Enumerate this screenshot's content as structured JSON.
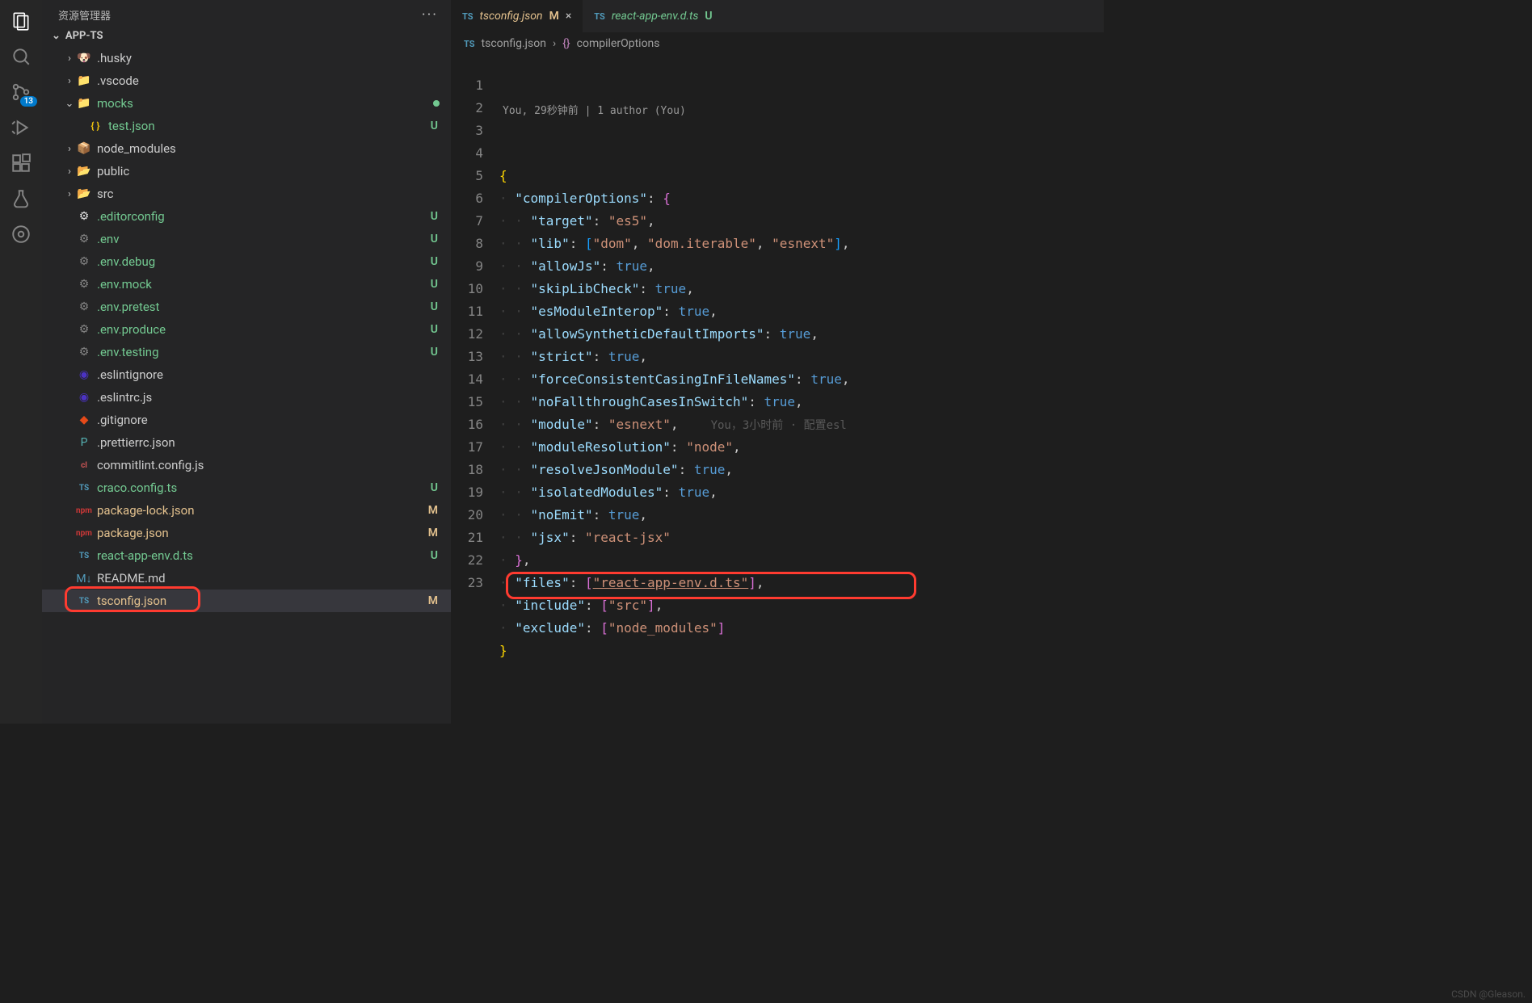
{
  "activityBar": {
    "badge": "13"
  },
  "sidebar": {
    "title": "资源管理器",
    "project": "APP-TS",
    "tree": [
      {
        "type": "folder",
        "name": ".husky",
        "depth": 1,
        "expanded": false,
        "color": "normal",
        "icon": "folder-husky"
      },
      {
        "type": "folder",
        "name": ".vscode",
        "depth": 1,
        "expanded": false,
        "color": "normal",
        "icon": "folder-vscode"
      },
      {
        "type": "folder",
        "name": "mocks",
        "depth": 1,
        "expanded": true,
        "color": "u",
        "status": "dot",
        "icon": "folder-mock"
      },
      {
        "type": "file",
        "name": "test.json",
        "depth": 2,
        "color": "u",
        "status": "U",
        "icon": "json"
      },
      {
        "type": "folder",
        "name": "node_modules",
        "depth": 1,
        "expanded": false,
        "color": "normal",
        "icon": "folder-node"
      },
      {
        "type": "folder",
        "name": "public",
        "depth": 1,
        "expanded": false,
        "color": "normal",
        "icon": "folder-public"
      },
      {
        "type": "folder",
        "name": "src",
        "depth": 1,
        "expanded": false,
        "color": "normal",
        "icon": "folder-src"
      },
      {
        "type": "file",
        "name": ".editorconfig",
        "depth": 1,
        "color": "u",
        "status": "U",
        "icon": "editorconfig"
      },
      {
        "type": "file",
        "name": ".env",
        "depth": 1,
        "color": "u",
        "status": "U",
        "icon": "gear"
      },
      {
        "type": "file",
        "name": ".env.debug",
        "depth": 1,
        "color": "u",
        "status": "U",
        "icon": "gear"
      },
      {
        "type": "file",
        "name": ".env.mock",
        "depth": 1,
        "color": "u",
        "status": "U",
        "icon": "gear"
      },
      {
        "type": "file",
        "name": ".env.pretest",
        "depth": 1,
        "color": "u",
        "status": "U",
        "icon": "gear"
      },
      {
        "type": "file",
        "name": ".env.produce",
        "depth": 1,
        "color": "u",
        "status": "U",
        "icon": "gear"
      },
      {
        "type": "file",
        "name": ".env.testing",
        "depth": 1,
        "color": "u",
        "status": "U",
        "icon": "gear"
      },
      {
        "type": "file",
        "name": ".eslintignore",
        "depth": 1,
        "color": "normal",
        "status": "",
        "icon": "eslint"
      },
      {
        "type": "file",
        "name": ".eslintrc.js",
        "depth": 1,
        "color": "normal",
        "status": "",
        "icon": "eslint"
      },
      {
        "type": "file",
        "name": ".gitignore",
        "depth": 1,
        "color": "normal",
        "status": "",
        "icon": "git"
      },
      {
        "type": "file",
        "name": ".prettierrc.json",
        "depth": 1,
        "color": "normal",
        "status": "",
        "icon": "prettier"
      },
      {
        "type": "file",
        "name": "commitlint.config.js",
        "depth": 1,
        "color": "normal",
        "status": "",
        "icon": "commitlint"
      },
      {
        "type": "file",
        "name": "craco.config.ts",
        "depth": 1,
        "color": "u",
        "status": "U",
        "icon": "ts"
      },
      {
        "type": "file",
        "name": "package-lock.json",
        "depth": 1,
        "color": "m",
        "status": "M",
        "icon": "npm"
      },
      {
        "type": "file",
        "name": "package.json",
        "depth": 1,
        "color": "m",
        "status": "M",
        "icon": "npm"
      },
      {
        "type": "file",
        "name": "react-app-env.d.ts",
        "depth": 1,
        "color": "u",
        "status": "U",
        "icon": "ts"
      },
      {
        "type": "file",
        "name": "README.md",
        "depth": 1,
        "color": "normal",
        "status": "",
        "icon": "md"
      },
      {
        "type": "file",
        "name": "tsconfig.json",
        "depth": 1,
        "color": "m",
        "status": "M",
        "icon": "ts",
        "selected": true
      }
    ]
  },
  "tabs": [
    {
      "label": "tsconfig.json",
      "status": "M",
      "statusColor": "m",
      "active": true,
      "icon": "ts"
    },
    {
      "label": "react-app-env.d.ts",
      "status": "U",
      "statusColor": "u",
      "active": false,
      "icon": "ts"
    }
  ],
  "breadcrumb": {
    "file": "tsconfig.json",
    "symbol": "compilerOptions"
  },
  "codelens": "You, 29秒钟前 | 1 author (You)",
  "gitlensInline": "You，3小时前 · 配置esl",
  "code": {
    "lines": [
      {
        "n": 1,
        "tokens": [
          [
            "brace",
            "{"
          ]
        ]
      },
      {
        "n": 2,
        "tokens": [
          [
            "ind",
            1
          ],
          [
            "key",
            "\"compilerOptions\""
          ],
          [
            "punc",
            ": "
          ],
          [
            "brace2",
            "{"
          ]
        ]
      },
      {
        "n": 3,
        "tokens": [
          [
            "ind",
            2
          ],
          [
            "key",
            "\"target\""
          ],
          [
            "punc",
            ": "
          ],
          [
            "str",
            "\"es5\""
          ],
          [
            "punc",
            ","
          ]
        ]
      },
      {
        "n": 4,
        "tokens": [
          [
            "ind",
            2
          ],
          [
            "key",
            "\"lib\""
          ],
          [
            "punc",
            ": "
          ],
          [
            "bracket",
            "["
          ],
          [
            "str",
            "\"dom\""
          ],
          [
            "punc",
            ", "
          ],
          [
            "str",
            "\"dom.iterable\""
          ],
          [
            "punc",
            ", "
          ],
          [
            "str",
            "\"esnext\""
          ],
          [
            "bracket",
            "]"
          ],
          [
            "punc",
            ","
          ]
        ]
      },
      {
        "n": 5,
        "tokens": [
          [
            "ind",
            2
          ],
          [
            "key",
            "\"allowJs\""
          ],
          [
            "punc",
            ": "
          ],
          [
            "bool",
            "true"
          ],
          [
            "punc",
            ","
          ]
        ]
      },
      {
        "n": 6,
        "tokens": [
          [
            "ind",
            2
          ],
          [
            "key",
            "\"skipLibCheck\""
          ],
          [
            "punc",
            ": "
          ],
          [
            "bool",
            "true"
          ],
          [
            "punc",
            ","
          ]
        ]
      },
      {
        "n": 7,
        "tokens": [
          [
            "ind",
            2
          ],
          [
            "key",
            "\"esModuleInterop\""
          ],
          [
            "punc",
            ": "
          ],
          [
            "bool",
            "true"
          ],
          [
            "punc",
            ","
          ]
        ]
      },
      {
        "n": 8,
        "tokens": [
          [
            "ind",
            2
          ],
          [
            "key",
            "\"allowSyntheticDefaultImports\""
          ],
          [
            "punc",
            ": "
          ],
          [
            "bool",
            "true"
          ],
          [
            "punc",
            ","
          ]
        ]
      },
      {
        "n": 9,
        "tokens": [
          [
            "ind",
            2
          ],
          [
            "key",
            "\"strict\""
          ],
          [
            "punc",
            ": "
          ],
          [
            "bool",
            "true"
          ],
          [
            "punc",
            ","
          ]
        ]
      },
      {
        "n": 10,
        "tokens": [
          [
            "ind",
            2
          ],
          [
            "key",
            "\"forceConsistentCasingInFileNames\""
          ],
          [
            "punc",
            ": "
          ],
          [
            "bool",
            "true"
          ],
          [
            "punc",
            ","
          ]
        ]
      },
      {
        "n": 11,
        "tokens": [
          [
            "ind",
            2
          ],
          [
            "key",
            "\"noFallthroughCasesInSwitch\""
          ],
          [
            "punc",
            ": "
          ],
          [
            "bool",
            "true"
          ],
          [
            "punc",
            ","
          ]
        ]
      },
      {
        "n": 12,
        "tokens": [
          [
            "ind",
            2
          ],
          [
            "key",
            "\"module\""
          ],
          [
            "punc",
            ": "
          ],
          [
            "str",
            "\"esnext\""
          ],
          [
            "punc",
            ","
          ]
        ],
        "gitlens": true
      },
      {
        "n": 13,
        "tokens": [
          [
            "ind",
            2
          ],
          [
            "key",
            "\"moduleResolution\""
          ],
          [
            "punc",
            ": "
          ],
          [
            "str",
            "\"node\""
          ],
          [
            "punc",
            ","
          ]
        ]
      },
      {
        "n": 14,
        "tokens": [
          [
            "ind",
            2
          ],
          [
            "key",
            "\"resolveJsonModule\""
          ],
          [
            "punc",
            ": "
          ],
          [
            "bool",
            "true"
          ],
          [
            "punc",
            ","
          ]
        ]
      },
      {
        "n": 15,
        "tokens": [
          [
            "ind",
            2
          ],
          [
            "key",
            "\"isolatedModules\""
          ],
          [
            "punc",
            ": "
          ],
          [
            "bool",
            "true"
          ],
          [
            "punc",
            ","
          ]
        ]
      },
      {
        "n": 16,
        "tokens": [
          [
            "ind",
            2
          ],
          [
            "key",
            "\"noEmit\""
          ],
          [
            "punc",
            ": "
          ],
          [
            "bool",
            "true"
          ],
          [
            "punc",
            ","
          ]
        ]
      },
      {
        "n": 17,
        "tokens": [
          [
            "ind",
            2
          ],
          [
            "key",
            "\"jsx\""
          ],
          [
            "punc",
            ": "
          ],
          [
            "str",
            "\"react-jsx\""
          ]
        ]
      },
      {
        "n": 18,
        "tokens": [
          [
            "ind",
            1
          ],
          [
            "brace2",
            "}"
          ],
          [
            "punc",
            ","
          ]
        ]
      },
      {
        "n": 19,
        "tokens": [
          [
            "ind",
            1
          ],
          [
            "key",
            "\"files\""
          ],
          [
            "punc",
            ": "
          ],
          [
            "brace2",
            "["
          ],
          [
            "str",
            "\"react-app-env.d.ts\""
          ],
          [
            "brace2",
            "]"
          ],
          [
            "punc",
            ","
          ]
        ],
        "underline": true
      },
      {
        "n": 20,
        "tokens": [
          [
            "ind",
            1
          ],
          [
            "key",
            "\"include\""
          ],
          [
            "punc",
            ": "
          ],
          [
            "brace2",
            "["
          ],
          [
            "str",
            "\"src\""
          ],
          [
            "brace2",
            "]"
          ],
          [
            "punc",
            ","
          ]
        ]
      },
      {
        "n": 21,
        "tokens": [
          [
            "ind",
            1
          ],
          [
            "key",
            "\"exclude\""
          ],
          [
            "punc",
            ": "
          ],
          [
            "brace2",
            "["
          ],
          [
            "str",
            "\"node_modules\""
          ],
          [
            "brace2",
            "]"
          ]
        ]
      },
      {
        "n": 22,
        "tokens": [
          [
            "brace",
            "}"
          ]
        ]
      },
      {
        "n": 23,
        "tokens": []
      }
    ]
  },
  "watermark": "CSDN @Gleason."
}
